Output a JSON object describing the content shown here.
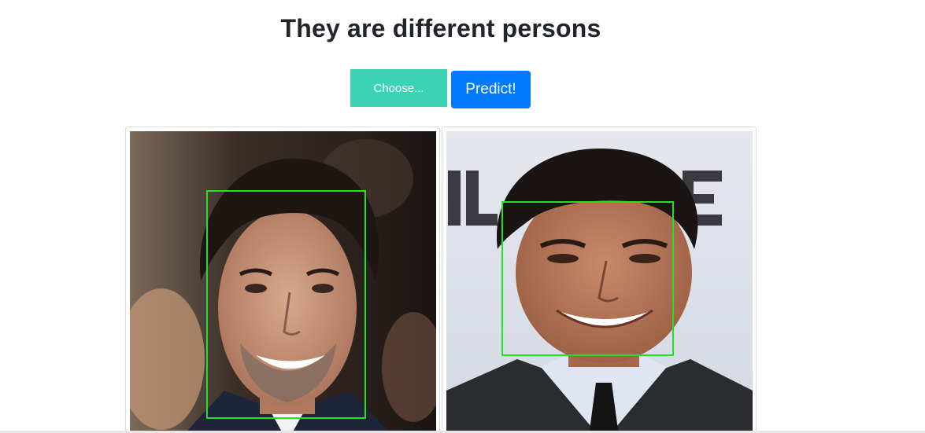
{
  "header": {
    "title": "They are different persons"
  },
  "controls": {
    "choose_label": "Choose...",
    "predict_label": "Predict!"
  },
  "images": [
    {
      "name": "left-face-photo",
      "face_detected": true
    },
    {
      "name": "right-face-photo",
      "face_detected": true
    }
  ],
  "colors": {
    "choose_button": "#3ad4b4",
    "predict_button": "#007bff",
    "face_box": "#22e022"
  }
}
